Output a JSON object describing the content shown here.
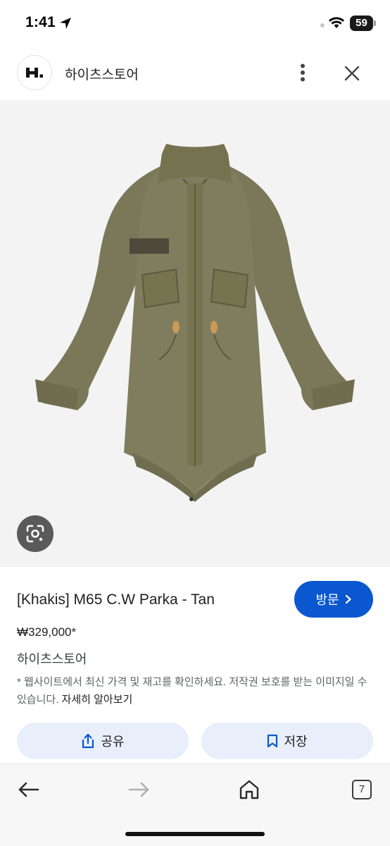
{
  "status": {
    "time": "1:41",
    "battery": "59"
  },
  "header": {
    "site_name": "하이츠스토어",
    "logo_text": "H."
  },
  "product": {
    "title": "[Khakis] M65 C.W Parka - Tan",
    "price": "₩329,000*",
    "seller": "하이츠스토어",
    "disclaimer": "* 웹사이트에서 최신 가격 및 재고를 확인하세요. 저작권 보호를 받는 이미지일 수 있습니다.",
    "learn_more": "자세히 알아보기"
  },
  "actions": {
    "visit_label": "방문",
    "share_label": "공유",
    "save_label": "저장"
  },
  "toolbar": {
    "tab_count": "7"
  },
  "colors": {
    "primary": "#0b57d0",
    "action_bg": "#e8effb",
    "jacket": "#7d7a5c"
  },
  "icons": [
    "location-arrow-icon",
    "wifi-icon",
    "more-vert-icon",
    "close-icon",
    "google-lens-icon",
    "chevron-right-icon",
    "share-icon",
    "bookmark-icon",
    "back-arrow-icon",
    "forward-arrow-icon",
    "home-icon",
    "tabs-icon"
  ]
}
